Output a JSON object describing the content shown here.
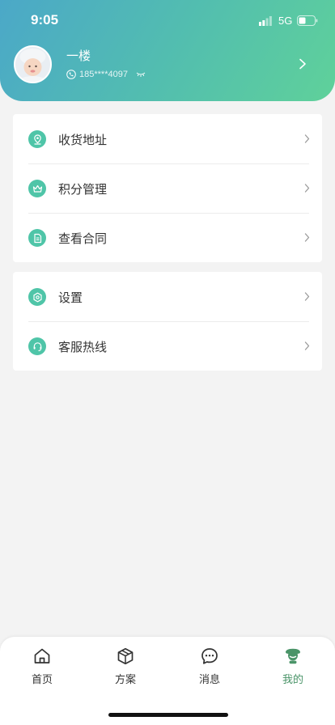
{
  "status_bar": {
    "time": "9:05",
    "network": "5G",
    "signal_icon": "signal-bars-icon",
    "battery_icon": "battery-icon"
  },
  "profile": {
    "name": "一楼",
    "phone": "185****4097",
    "phone_icon": "phone-icon",
    "toggle_icon": "eye-closed-icon",
    "chevron_icon": "chevron-right-icon"
  },
  "menu_group_1": {
    "items": [
      {
        "label": "收货地址",
        "icon": "location-pin-icon"
      },
      {
        "label": "积分管理",
        "icon": "crown-icon"
      },
      {
        "label": "查看合同",
        "icon": "document-icon"
      }
    ]
  },
  "menu_group_2": {
    "items": [
      {
        "label": "设置",
        "icon": "settings-icon"
      },
      {
        "label": "客服热线",
        "icon": "headset-icon"
      }
    ]
  },
  "tabbar": {
    "tabs": [
      {
        "label": "首页",
        "icon": "home-icon",
        "active": false
      },
      {
        "label": "方案",
        "icon": "box-icon",
        "active": false
      },
      {
        "label": "消息",
        "icon": "chat-icon",
        "active": false
      },
      {
        "label": "我的",
        "icon": "profile-icon",
        "active": true
      }
    ]
  },
  "colors": {
    "header_gradient_start": "#4ba8c8",
    "header_gradient_end": "#5fd19a",
    "menu_icon_bg": "#4fc5a8",
    "active_tab": "#4a9468"
  }
}
